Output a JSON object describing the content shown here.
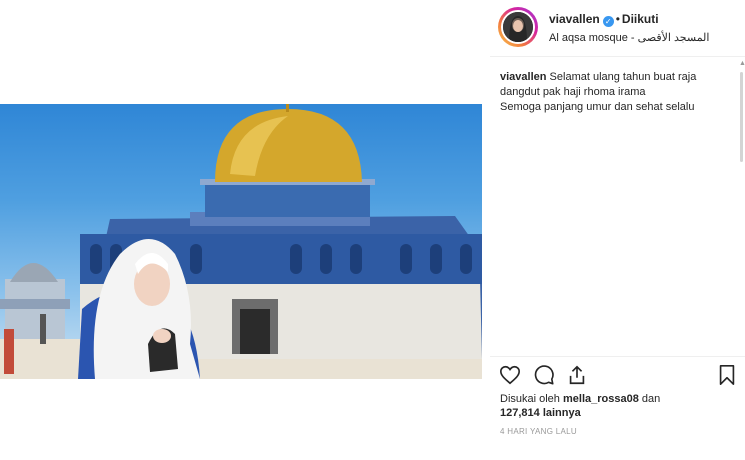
{
  "post": {
    "username": "viavallen",
    "follow_label": "Diikuti",
    "location": "Al aqsa mosque - المسجد الأقصى"
  },
  "caption": {
    "username": "viavallen",
    "line1": "Selamat ulang tahun buat raja",
    "line2": "dangdut pak haji rhoma irama",
    "line3": "Semoga panjang umur dan sehat selalu"
  },
  "likes": {
    "prefix": "Disukai oleh",
    "user": "mella_rossa08",
    "suffix": "dan",
    "count": "127,814",
    "suffix2": "lainnya"
  },
  "time": "4 HARI YANG LALU",
  "icons": {
    "like": "heart-icon",
    "comment": "comment-icon",
    "share": "share-icon",
    "save": "bookmark-icon",
    "verified": "verified-badge-icon"
  },
  "colors": {
    "verified": "#3897f0",
    "sky": "#4f9fe0",
    "dome": "#d4a72c"
  }
}
